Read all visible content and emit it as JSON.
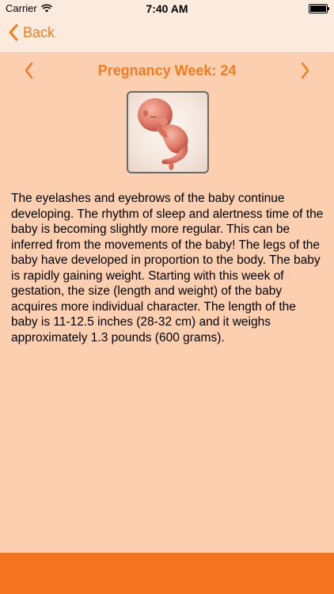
{
  "status_bar": {
    "carrier": "Carrier",
    "time": "7:40 AM"
  },
  "nav": {
    "back_label": "Back"
  },
  "week": {
    "title": "Pregnancy Week: 24"
  },
  "description": "The eyelashes and eyebrows of the baby continue developing. The rhythm of sleep and alertness time of the baby is becoming slightly more regular. This can be inferred from the movements of the baby! The legs of the baby have developed in proportion to the body. The baby is rapidly gaining weight. Starting with this week of gestation, the size (length and weight) of the baby acquires more individual character. The length of the baby is 11-12.5 inches (28-32 cm) and it weighs approximately 1.3 pounds (600 grams).",
  "colors": {
    "accent": "#f47b20",
    "background": "#fbcfb0",
    "nav_background": "#fbeade",
    "bottom_bar": "#f47321"
  },
  "icons": {
    "wifi": "wifi-icon",
    "battery": "battery-icon",
    "back": "chevron-left-icon",
    "prev_week": "chevron-left-icon",
    "next_week": "chevron-right-icon"
  }
}
